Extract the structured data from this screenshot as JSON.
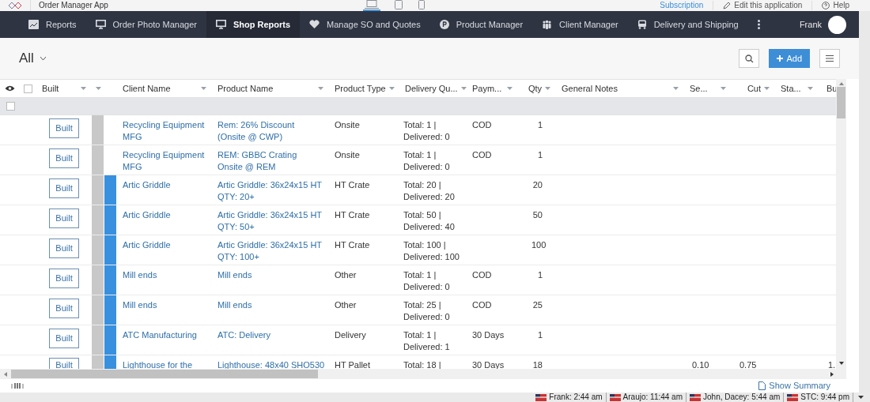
{
  "app": {
    "title": "Order Manager App",
    "devices": [
      {
        "kind": "laptop",
        "selected": true
      },
      {
        "kind": "tablet",
        "selected": false
      },
      {
        "kind": "phone",
        "selected": false
      }
    ],
    "links": [
      {
        "kind": "subscription",
        "label": "Subscription"
      },
      {
        "kind": "edit",
        "label": "Edit this application"
      },
      {
        "kind": "help",
        "label": "Help"
      }
    ]
  },
  "nav": {
    "items": [
      {
        "label": "Reports",
        "selected": false
      },
      {
        "label": "Order Photo Manager",
        "selected": false
      },
      {
        "label": "Shop Reports",
        "selected": true
      },
      {
        "label": "Manage SO and Quotes",
        "selected": false
      },
      {
        "label": "Product Manager",
        "selected": false
      },
      {
        "label": "Client Manager",
        "selected": false
      },
      {
        "label": "Delivery and Shipping",
        "selected": false
      }
    ],
    "user": "Frank"
  },
  "view": {
    "filter": "All",
    "add_label": "Add"
  },
  "table": {
    "select_all": {
      "checked": false
    },
    "filter_row": {
      "checked": false
    },
    "columns": {
      "built": "Built",
      "client": "Client Name",
      "product": "Product Name",
      "type": "Product Type",
      "delivery": "Delivery Qu...",
      "payment": "Paym...",
      "qty": "Qty",
      "notes": "General Notes",
      "se": "Se...",
      "cut": "Cut",
      "sta": "Sta...",
      "bu": "Bu"
    },
    "rows": [
      {
        "button": "Built",
        "marked": false,
        "client": "Recycling Equipment MFG",
        "product": "Rem: 26% Discount (Onsite @ CWP)",
        "type": "Onsite",
        "delivery": [
          "Total: 1 |",
          "Delivered: 0"
        ],
        "payment": "COD",
        "qty": "1"
      },
      {
        "button": "Built",
        "marked": false,
        "client": "Recycling Equipment MFG",
        "product": "REM: GBBC Crating Onsite @ REM",
        "type": "Onsite",
        "delivery": [
          "Total: 1 |",
          "Delivered: 0"
        ],
        "payment": "COD",
        "qty": "1"
      },
      {
        "button": "Built",
        "marked": true,
        "client": "Artic Griddle",
        "product": "Artic Griddle: 36x24x15 HT QTY: 20+",
        "type": "HT Crate",
        "delivery": [
          "Total: 20 |",
          "Delivered: 20"
        ],
        "qty": "20"
      },
      {
        "button": "Built",
        "marked": true,
        "client": "Artic Griddle",
        "product": "Artic Griddle: 36x24x15 HT QTY: 50+",
        "type": "HT Crate",
        "delivery": [
          "Total: 50 |",
          "Delivered: 40"
        ],
        "qty": "50"
      },
      {
        "button": "Built",
        "marked": true,
        "client": "Artic Griddle",
        "product": "Artic Griddle: 36x24x15 HT QTY: 100+",
        "type": "HT Crate",
        "delivery": [
          "Total: 100 |",
          "Delivered: 100"
        ],
        "qty": "100"
      },
      {
        "button": "Built",
        "marked": true,
        "client": "Mill ends",
        "product": "Mill ends",
        "type": "Other",
        "delivery": [
          "Total: 1 |",
          "Delivered: 0"
        ],
        "payment": "COD",
        "qty": "1"
      },
      {
        "button": "Built",
        "marked": true,
        "client": "Mill ends",
        "product": "Mill ends",
        "type": "Other",
        "delivery": [
          "Total: 25 |",
          "Delivered: 0"
        ],
        "payment": "COD",
        "qty": "25"
      },
      {
        "button": "Built",
        "marked": true,
        "client": "ATC Manufacturing",
        "product": "ATC: Delivery",
        "type": "Delivery",
        "delivery": [
          "Total: 1 |",
          "Delivered: 1"
        ],
        "payment": "30 Days",
        "qty": "1"
      },
      {
        "button": "Built",
        "marked": true,
        "client": "Lighthouse for the",
        "product": "Lighthouse: 48x40 SHO530",
        "type": "HT Pallet",
        "delivery": [
          "Total: 18 |"
        ],
        "payment": "30 Days",
        "qty": "18",
        "se": "0.10",
        "cut": "0.75",
        "bu": "1."
      }
    ]
  },
  "summary_link": "Show Summary",
  "clocks": [
    {
      "label": "Frank: 2:44 am"
    },
    {
      "label": "Araujo: 11:44 am"
    },
    {
      "label": "John, Dacey: 5:44 am"
    },
    {
      "label": "STC: 9:44 pm"
    }
  ]
}
